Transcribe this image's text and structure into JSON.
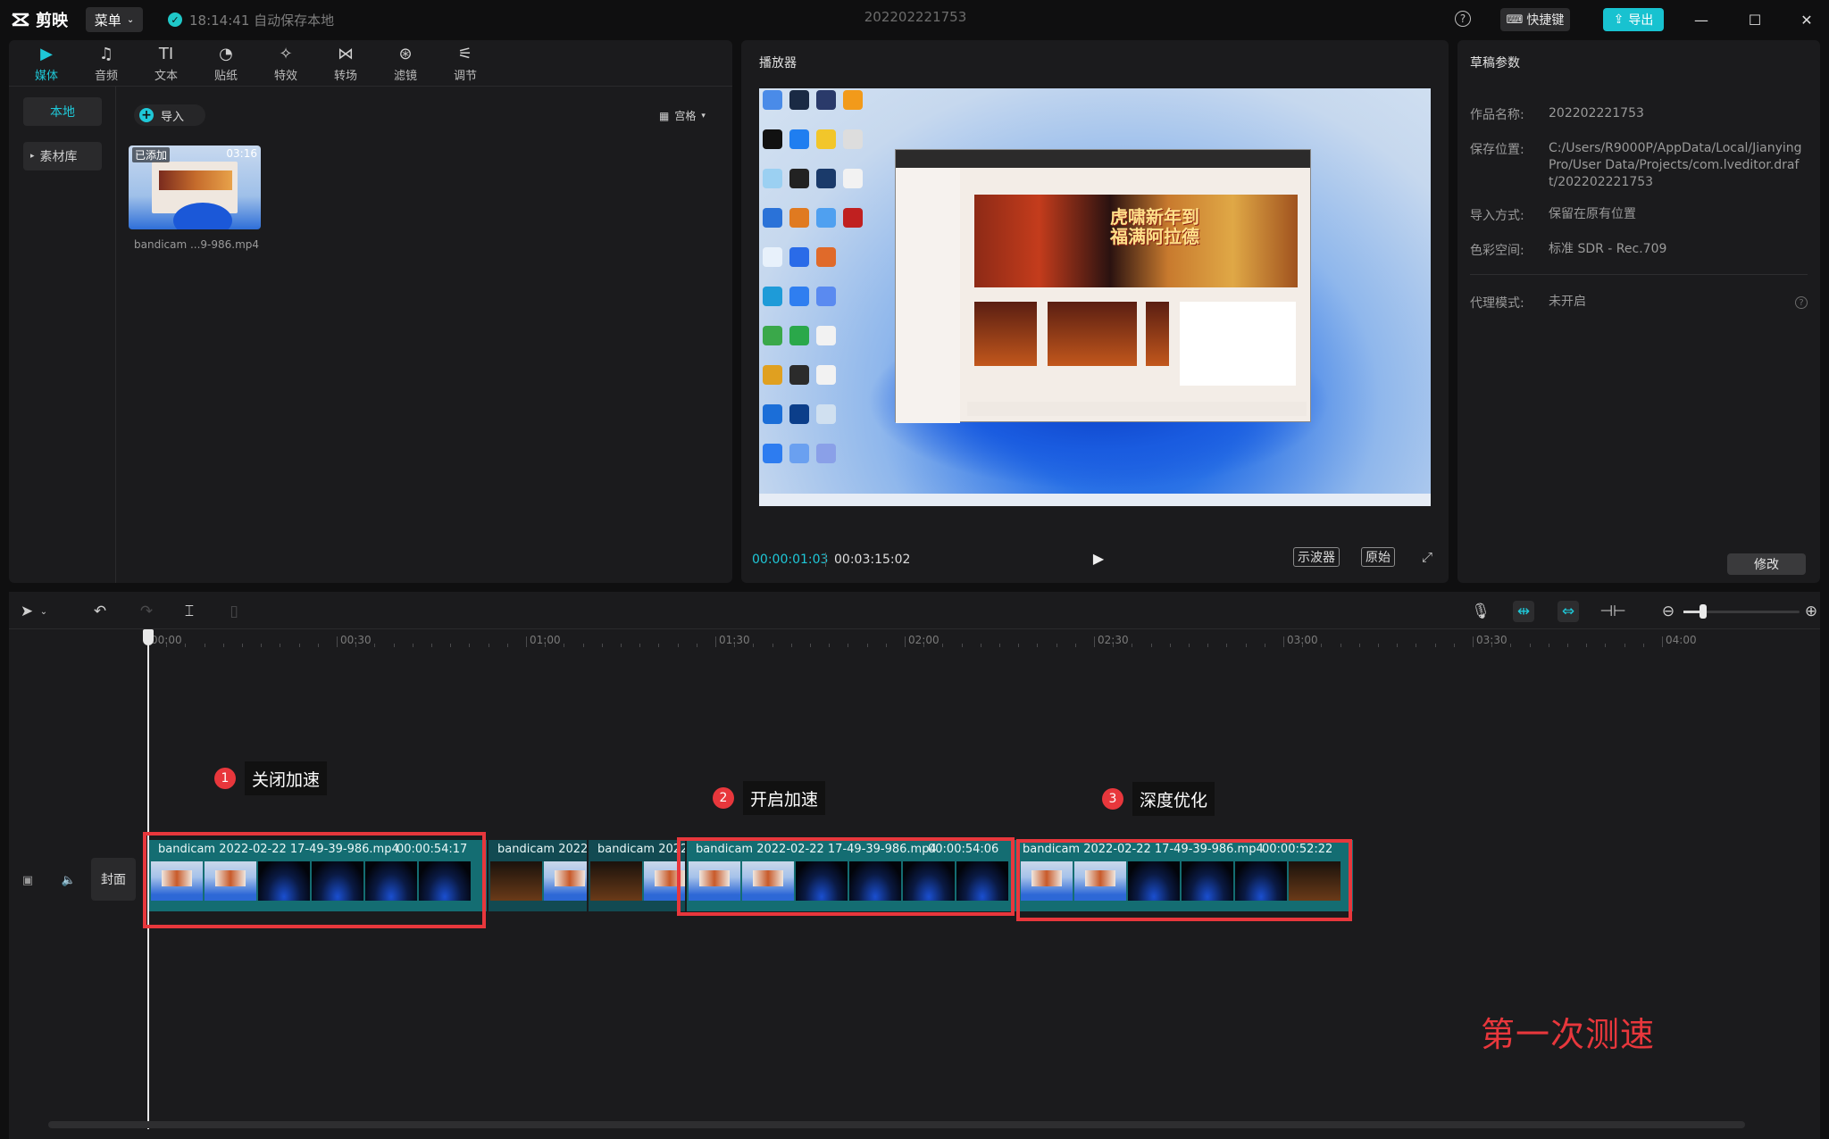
{
  "titlebar": {
    "app_name": "剪映",
    "menu_label": "菜单",
    "autosave_text": "18:14:41 自动保存本地",
    "doc_title": "202202221753",
    "shortcut_label": "快捷键",
    "export_label": "导出"
  },
  "tabs": [
    {
      "label": "媒体",
      "icon": "▶"
    },
    {
      "label": "音频",
      "icon": "♫"
    },
    {
      "label": "文本",
      "icon": "TI"
    },
    {
      "label": "贴纸",
      "icon": "◔"
    },
    {
      "label": "特效",
      "icon": "✧"
    },
    {
      "label": "转场",
      "icon": "⋈"
    },
    {
      "label": "滤镜",
      "icon": "⊛"
    },
    {
      "label": "调节",
      "icon": "⚟"
    }
  ],
  "media": {
    "side_local": "本地",
    "side_library": "素材库",
    "import_label": "导入",
    "view_label": "宫格",
    "thumb_tag": "已添加",
    "thumb_duration": "03:16",
    "thumb_name": "bandicam ...9-986.mp4"
  },
  "player": {
    "title": "播放器",
    "app_hero_text": "虎啸新年到\n福满阿拉德",
    "current_time": "00:00:01:03",
    "total_time": "00:03:15:02",
    "scope_label": "示波器",
    "original_label": "原始"
  },
  "props": {
    "title": "草稿参数",
    "rows": [
      {
        "label": "作品名称:",
        "value": "202202221753"
      },
      {
        "label": "保存位置:",
        "value": "C:/Users/R9000P/AppData/Local/JianyingPro/User Data/Projects/com.lveditor.draft/202202221753"
      },
      {
        "label": "导入方式:",
        "value": "保留在原有位置"
      },
      {
        "label": "色彩空间:",
        "value": "标准 SDR - Rec.709"
      },
      {
        "label": "代理模式:",
        "value": "未开启"
      }
    ],
    "modify_label": "修改"
  },
  "timeline": {
    "ruler": [
      "00:00",
      "00:30",
      "01:00",
      "01:30",
      "02:00",
      "02:30",
      "03:00",
      "03:30",
      "04:00"
    ],
    "cover_label": "封面",
    "clips": [
      {
        "name": "bandicam 2022-02-22 17-49-39-986.mp4",
        "duration": "00:00:54:17"
      },
      {
        "name": "bandicam 2022-",
        "duration": ""
      },
      {
        "name": "bandicam 2022-",
        "duration": ""
      },
      {
        "name": "bandicam 2022-02-22 17-49-39-986.mp4",
        "duration": "00:00:54:06"
      },
      {
        "name": "bandicam 2022-02-22 17-49-39-986.mp4",
        "duration": "00:00:52:22"
      }
    ]
  },
  "annotations": {
    "items": [
      {
        "number": "1",
        "label": "关闭加速"
      },
      {
        "number": "2",
        "label": "开启加速"
      },
      {
        "number": "3",
        "label": "深度优化"
      }
    ],
    "caption": "第一次测速",
    "color": "#e8373c"
  },
  "colors": {
    "accent": "#1fc8d8",
    "clip": "#146d72"
  }
}
